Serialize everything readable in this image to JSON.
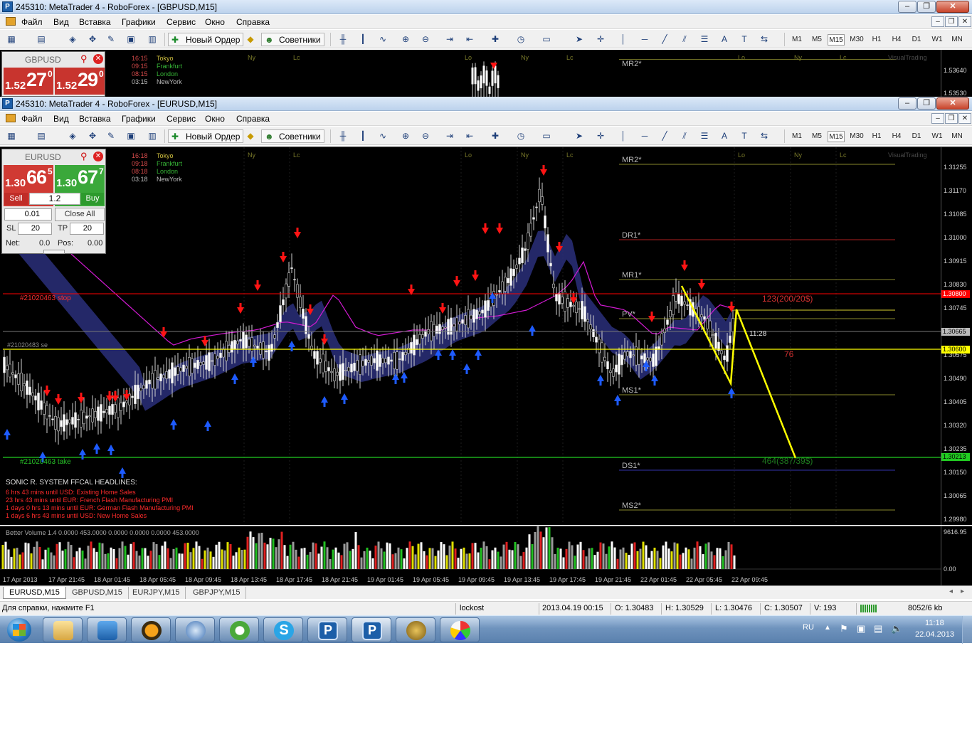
{
  "windows": [
    {
      "title": "245310: MetaTrader 4 - RoboForex - [GBPUSD,M15]",
      "symbol": "GBPUSD",
      "bid_prefix": "1.52",
      "bid_big": "27",
      "bid_sup": "0",
      "ask_prefix": "1.52",
      "ask_big": "29",
      "ask_sup": "0",
      "times": [
        "16:15",
        "09:15",
        "08:15",
        "03:15"
      ],
      "axis_top": "1.53640",
      "axis_bottom": "1.53530",
      "pivot_top": "MR2*"
    },
    {
      "title": "245310: MetaTrader 4 - RoboForex - [EURUSD,M15]",
      "symbol": "EURUSD",
      "bid_prefix": "1.30",
      "bid_big": "66",
      "bid_sup": "5",
      "ask_prefix": "1.30",
      "ask_big": "67",
      "ask_sup": "7",
      "times": [
        "16:18",
        "09:18",
        "08:18",
        "03:18"
      ]
    }
  ],
  "window_buttons": {
    "minimize": "–",
    "restore": "❐",
    "close": "✕"
  },
  "menu": [
    "Файл",
    "Вид",
    "Вставка",
    "Графики",
    "Сервис",
    "Окно",
    "Справка"
  ],
  "toolbar": {
    "new_order": "Новый Ордер",
    "experts": "Советники"
  },
  "timeframes": [
    "M1",
    "M5",
    "M15",
    "M30",
    "H1",
    "H4",
    "D1",
    "W1",
    "MN"
  ],
  "active_timeframe": "M15",
  "session_names": [
    "Tokyo",
    "Frankfurt",
    "London",
    "NewYork"
  ],
  "session_markers": {
    "ny": "Ny",
    "lc": "Lc",
    "lo": "Lo",
    "top_pane": [
      "Ny",
      "Lc",
      "Lo",
      "Ny",
      "Lc",
      "Lo",
      "Ny",
      "Lc"
    ],
    "main_pane": [
      "Ny",
      "Lc",
      "Lo",
      "Ny",
      "Lc",
      "Lo",
      "Ny",
      "Lc"
    ]
  },
  "watermark": "VisualTrading",
  "panel": {
    "sell": "Sell",
    "buy": "Buy",
    "lot_multiplier": "1.2",
    "lot": "0.01",
    "close_all": "Close All",
    "sl_label": "SL",
    "sl": "20",
    "tp_label": "TP",
    "tp": "20",
    "net_label": "Net:",
    "net": "0.0",
    "pos_label": "Pos:",
    "pos": "0.00"
  },
  "chart_labels": {
    "stop_line": "#21020463  stop",
    "sell_line": "#21020483 se",
    "take_line": "#21020463  take",
    "target_up": "123(200/20$)",
    "target_down": "464(387/39$)",
    "count": "76",
    "timer": "11:28"
  },
  "pivots": [
    "MR2*",
    "DR1*",
    "MR1*",
    "PV*",
    "MS1*",
    "DS1*",
    "MS2*"
  ],
  "price_axis": [
    "1.31255",
    "1.31170",
    "1.31085",
    "1.31000",
    "1.30915",
    "1.30830",
    "1.30745",
    "1.30575",
    "1.30490",
    "1.30405",
    "1.30320",
    "1.30235",
    "1.30150",
    "1.30065",
    "1.29980"
  ],
  "price_axis_boxes": {
    "stop": "1.30800",
    "current": "1.30665",
    "sell": "1.30600",
    "take": "1.30213"
  },
  "headlines": {
    "title": "SONIC R. SYSTEM  FFCAL HEADLINES:",
    "items": [
      "6 hrs 43 mins until USD: Existing Home Sales",
      "23 hrs 43 mins until EUR: French Flash Manufacturing PMI",
      "1 days 0 hrs 13 mins until EUR: German Flash Manufacturing PMI",
      "1 days 6 hrs 43 mins until USD: New Home Sales"
    ]
  },
  "volume": {
    "label": "Better Volume 1.4 0.0000 453.0000 0.0000 0.0000 0.0000 453.0000",
    "axis_top": "9616.95",
    "axis_bottom": "0.00"
  },
  "time_axis": [
    "17 Apr 2013",
    "17 Apr 21:45",
    "18 Apr 01:45",
    "18 Apr 05:45",
    "18 Apr 09:45",
    "18 Apr 13:45",
    "18 Apr 17:45",
    "18 Apr 21:45",
    "19 Apr 01:45",
    "19 Apr 05:45",
    "19 Apr 09:45",
    "19 Apr 13:45",
    "19 Apr 17:45",
    "19 Apr 21:45",
    "22 Apr 01:45",
    "22 Apr 05:45",
    "22 Apr 09:45"
  ],
  "chart_tabs": [
    "EURUSD,M15",
    "GBPUSD,M15",
    "EURJPY,M15",
    "GBPJPY,M15"
  ],
  "status": {
    "help": "Для справки, нажмите F1",
    "profile": "lockost",
    "datetime": "2013.04.19 00:15",
    "open": "O: 1.30483",
    "high": "H: 1.30529",
    "low": "L: 1.30476",
    "close": "C: 1.30507",
    "volume": "V: 193",
    "traffic": "8052/6 kb"
  },
  "taskbar": {
    "lang": "RU",
    "time": "11:18",
    "date": "22.04.2013",
    "apps": [
      "explorer-icon",
      "remote-desktop-icon",
      "avast-icon",
      "thunderbird-icon",
      "utorrent-icon",
      "skype-icon",
      "metatrader-icon",
      "metatrader-icon",
      "lion-app-icon",
      "paint-icon"
    ]
  },
  "colors": {
    "chart_bg": "#000000",
    "sell": "#d62a2a",
    "buy": "#2ea82e",
    "stop_line": "#ff0000",
    "sell_line": "#ffff00",
    "take_line": "#22cc22",
    "band": "#2a2f7a",
    "arrow_down": "#ff1414",
    "arrow_up": "#1e5bff",
    "pattern": "#ffff00"
  }
}
